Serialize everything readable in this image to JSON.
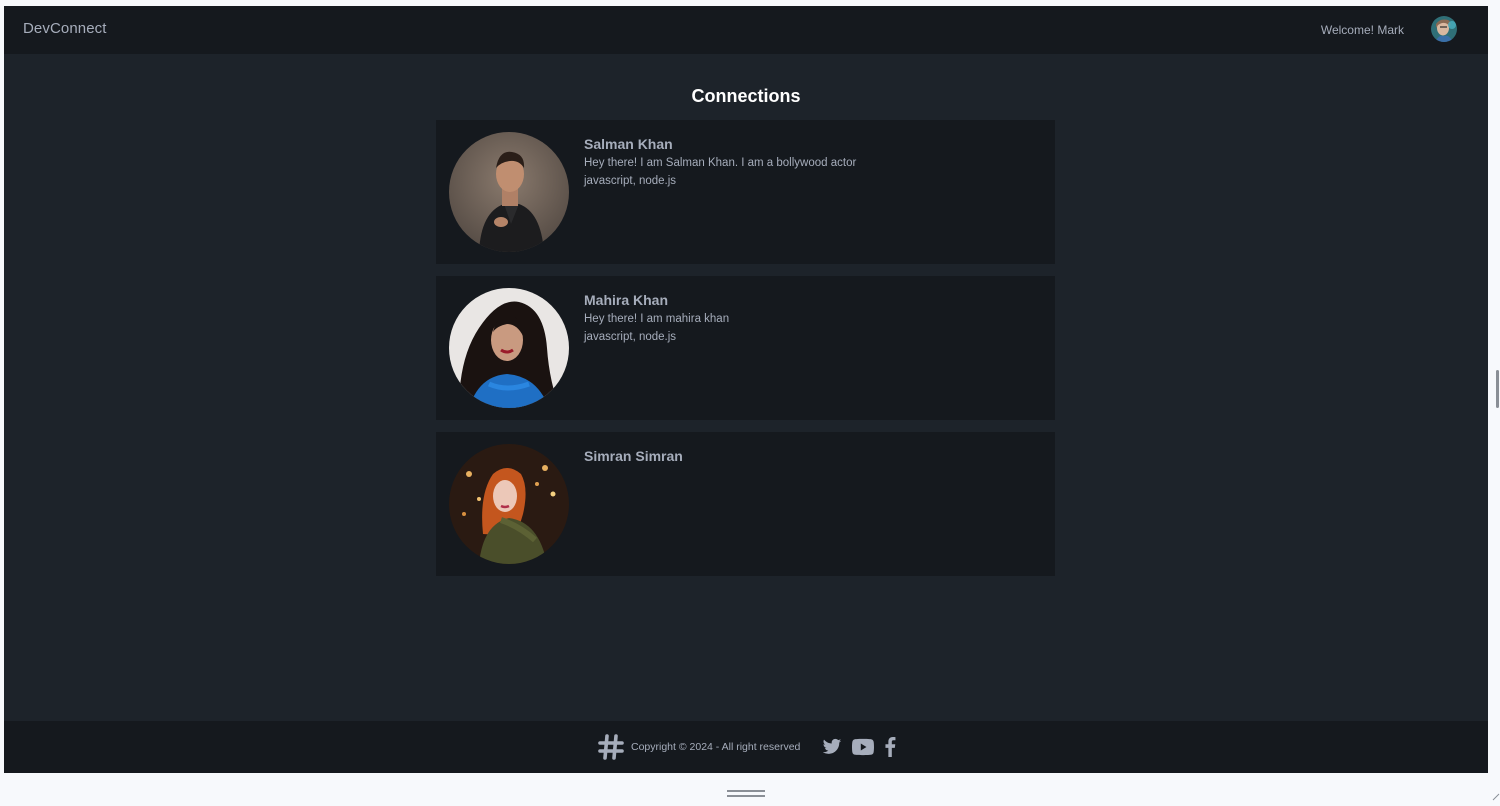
{
  "app": {
    "brand": "DevConnect",
    "welcome": "Welcome! Mark"
  },
  "page": {
    "title": "Connections"
  },
  "connections": [
    {
      "name": "Salman Khan",
      "about": "Hey there! I am Salman Khan. I am a bollywood actor",
      "skills": "javascript, node.js"
    },
    {
      "name": "Mahira Khan",
      "about": "Hey there! I am mahira khan",
      "skills": "javascript, node.js"
    },
    {
      "name": "Simran Simran",
      "about": "",
      "skills": ""
    }
  ],
  "footer": {
    "copyright": "Copyright © 2024 - All right reserved",
    "icons": [
      "hash-logo-icon",
      "twitter-icon",
      "youtube-icon",
      "facebook-icon"
    ]
  },
  "colors": {
    "page_bg": "#1d232a",
    "bar_bg": "#15191e",
    "text_muted": "#a6adbb",
    "heading": "#ffffff"
  }
}
